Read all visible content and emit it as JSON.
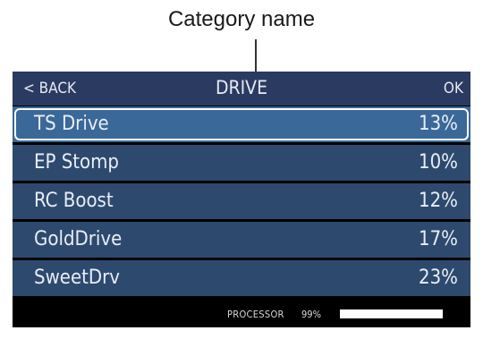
{
  "callout": {
    "label": "Category name"
  },
  "header": {
    "back": "< BACK",
    "title": "DRIVE",
    "ok": "OK"
  },
  "list": {
    "items": [
      {
        "name": "TS Drive",
        "percent": "13%",
        "selected": true
      },
      {
        "name": "EP Stomp",
        "percent": "10%",
        "selected": false
      },
      {
        "name": "RC Boost",
        "percent": "12%",
        "selected": false
      },
      {
        "name": "GoldDrive",
        "percent": "17%",
        "selected": false
      },
      {
        "name": "SweetDrv",
        "percent": "23%",
        "selected": false
      }
    ]
  },
  "footer": {
    "processor_label": "PROCESSOR",
    "processor_value": "99%",
    "processor_fraction": 0.99
  },
  "colors": {
    "header_bg": "#2b3a60",
    "row_bg": "#2d4a6e",
    "selected_bg": "#3a6898"
  }
}
